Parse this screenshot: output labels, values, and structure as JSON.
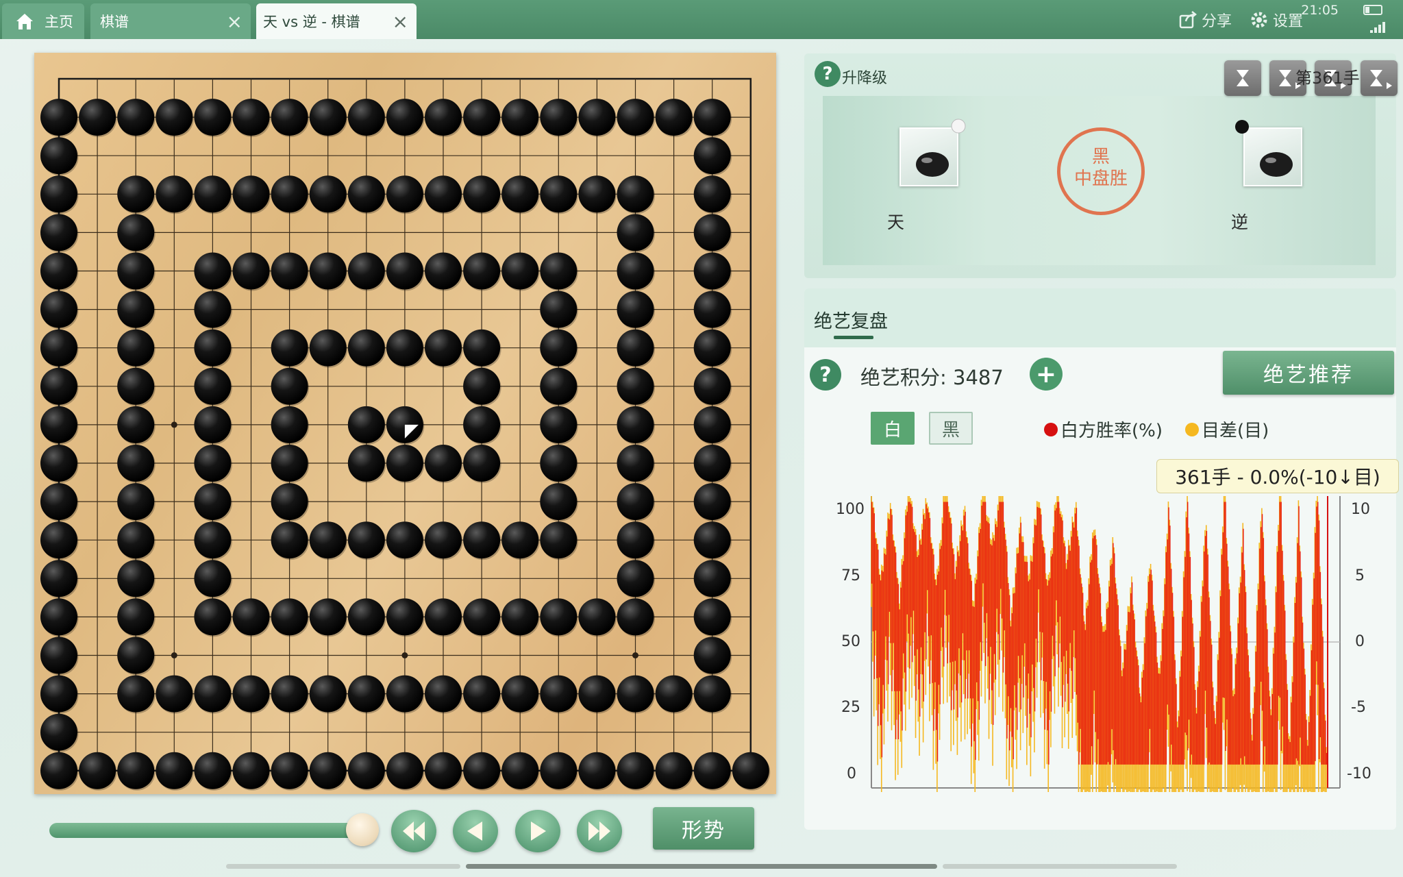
{
  "tabs": {
    "home": "主页",
    "record": "棋谱",
    "active": "天 vs 逆 - 棋谱",
    "close_glyph": "×"
  },
  "status": {
    "share": "分享",
    "settings": "设置",
    "time": "21:05"
  },
  "board": {
    "size": 19,
    "stones_black": [
      [
        0,
        1
      ],
      [
        1,
        1
      ],
      [
        2,
        1
      ],
      [
        3,
        1
      ],
      [
        4,
        1
      ],
      [
        5,
        1
      ],
      [
        6,
        1
      ],
      [
        7,
        1
      ],
      [
        8,
        1
      ],
      [
        9,
        1
      ],
      [
        10,
        1
      ],
      [
        11,
        1
      ],
      [
        12,
        1
      ],
      [
        13,
        1
      ],
      [
        14,
        1
      ],
      [
        15,
        1
      ],
      [
        16,
        1
      ],
      [
        17,
        1
      ],
      [
        0,
        2
      ],
      [
        17,
        2
      ],
      [
        0,
        3
      ],
      [
        2,
        3
      ],
      [
        3,
        3
      ],
      [
        4,
        3
      ],
      [
        5,
        3
      ],
      [
        6,
        3
      ],
      [
        7,
        3
      ],
      [
        8,
        3
      ],
      [
        9,
        3
      ],
      [
        10,
        3
      ],
      [
        11,
        3
      ],
      [
        12,
        3
      ],
      [
        13,
        3
      ],
      [
        14,
        3
      ],
      [
        15,
        3
      ],
      [
        17,
        3
      ],
      [
        0,
        4
      ],
      [
        2,
        4
      ],
      [
        15,
        4
      ],
      [
        17,
        4
      ],
      [
        0,
        5
      ],
      [
        2,
        5
      ],
      [
        4,
        5
      ],
      [
        5,
        5
      ],
      [
        6,
        5
      ],
      [
        7,
        5
      ],
      [
        8,
        5
      ],
      [
        9,
        5
      ],
      [
        10,
        5
      ],
      [
        11,
        5
      ],
      [
        12,
        5
      ],
      [
        13,
        5
      ],
      [
        15,
        5
      ],
      [
        17,
        5
      ],
      [
        0,
        6
      ],
      [
        2,
        6
      ],
      [
        4,
        6
      ],
      [
        13,
        6
      ],
      [
        15,
        6
      ],
      [
        17,
        6
      ],
      [
        0,
        7
      ],
      [
        2,
        7
      ],
      [
        4,
        7
      ],
      [
        6,
        7
      ],
      [
        7,
        7
      ],
      [
        8,
        7
      ],
      [
        9,
        7
      ],
      [
        10,
        7
      ],
      [
        11,
        7
      ],
      [
        13,
        7
      ],
      [
        15,
        7
      ],
      [
        17,
        7
      ],
      [
        0,
        8
      ],
      [
        2,
        8
      ],
      [
        4,
        8
      ],
      [
        6,
        8
      ],
      [
        11,
        8
      ],
      [
        13,
        8
      ],
      [
        15,
        8
      ],
      [
        17,
        8
      ],
      [
        0,
        9
      ],
      [
        2,
        9
      ],
      [
        4,
        9
      ],
      [
        6,
        9
      ],
      [
        8,
        9
      ],
      [
        9,
        9
      ],
      [
        11,
        9
      ],
      [
        13,
        9
      ],
      [
        15,
        9
      ],
      [
        17,
        9
      ],
      [
        0,
        10
      ],
      [
        2,
        10
      ],
      [
        4,
        10
      ],
      [
        6,
        10
      ],
      [
        8,
        10
      ],
      [
        9,
        10
      ],
      [
        10,
        10
      ],
      [
        11,
        10
      ],
      [
        13,
        10
      ],
      [
        15,
        10
      ],
      [
        17,
        10
      ],
      [
        0,
        11
      ],
      [
        2,
        11
      ],
      [
        4,
        11
      ],
      [
        6,
        11
      ],
      [
        13,
        11
      ],
      [
        15,
        11
      ],
      [
        17,
        11
      ],
      [
        0,
        12
      ],
      [
        2,
        12
      ],
      [
        4,
        12
      ],
      [
        6,
        12
      ],
      [
        7,
        12
      ],
      [
        8,
        12
      ],
      [
        9,
        12
      ],
      [
        10,
        12
      ],
      [
        11,
        12
      ],
      [
        12,
        12
      ],
      [
        13,
        12
      ],
      [
        15,
        12
      ],
      [
        17,
        12
      ],
      [
        0,
        13
      ],
      [
        2,
        13
      ],
      [
        4,
        13
      ],
      [
        15,
        13
      ],
      [
        17,
        13
      ],
      [
        0,
        14
      ],
      [
        2,
        14
      ],
      [
        4,
        14
      ],
      [
        5,
        14
      ],
      [
        6,
        14
      ],
      [
        7,
        14
      ],
      [
        8,
        14
      ],
      [
        9,
        14
      ],
      [
        10,
        14
      ],
      [
        11,
        14
      ],
      [
        12,
        14
      ],
      [
        13,
        14
      ],
      [
        14,
        14
      ],
      [
        15,
        14
      ],
      [
        17,
        14
      ],
      [
        0,
        15
      ],
      [
        2,
        15
      ],
      [
        17,
        15
      ],
      [
        0,
        16
      ],
      [
        2,
        16
      ],
      [
        3,
        16
      ],
      [
        4,
        16
      ],
      [
        5,
        16
      ],
      [
        6,
        16
      ],
      [
        7,
        16
      ],
      [
        8,
        16
      ],
      [
        9,
        16
      ],
      [
        10,
        16
      ],
      [
        11,
        16
      ],
      [
        12,
        16
      ],
      [
        13,
        16
      ],
      [
        14,
        16
      ],
      [
        15,
        16
      ],
      [
        16,
        16
      ],
      [
        17,
        16
      ],
      [
        0,
        17
      ],
      [
        0,
        18
      ],
      [
        1,
        18
      ],
      [
        2,
        18
      ],
      [
        3,
        18
      ],
      [
        4,
        18
      ],
      [
        5,
        18
      ],
      [
        6,
        18
      ],
      [
        7,
        18
      ],
      [
        8,
        18
      ],
      [
        9,
        18
      ],
      [
        10,
        18
      ],
      [
        11,
        18
      ],
      [
        12,
        18
      ],
      [
        13,
        18
      ],
      [
        14,
        18
      ],
      [
        15,
        18
      ],
      [
        16,
        18
      ],
      [
        17,
        18
      ],
      [
        18,
        18
      ]
    ],
    "last_move": [
      9,
      9
    ],
    "move_progress": 1.0
  },
  "controls": {
    "shape_button": "形势"
  },
  "game": {
    "rank_label": "升降级",
    "move_label": "第361手",
    "player_white": "天",
    "player_black": "逆",
    "result_line1": "黑",
    "result_line2": "中盘胜"
  },
  "analysis": {
    "title": "绝艺复盘",
    "score_label": "绝艺积分: 3487",
    "recommend_button": "绝艺推荐",
    "toggle_white": "白",
    "toggle_black": "黑",
    "legend_winrate": "白方胜率(%)",
    "legend_diff": "目差(目)",
    "tooltip": "361手 - 0.0%(-10↓目)"
  },
  "chart_data": {
    "type": "line",
    "x_range": [
      1,
      361
    ],
    "left_axis": {
      "label": "",
      "ticks": [
        "100",
        "75",
        "50",
        "25",
        "0"
      ],
      "ylim": [
        0,
        100
      ]
    },
    "right_axis": {
      "label": "",
      "ticks": [
        "10",
        "5",
        "0",
        "-5",
        "-10"
      ],
      "ylim": [
        -10,
        10
      ]
    },
    "series": [
      {
        "name": "白方胜率(%)",
        "color": "#e8150f"
      },
      {
        "name": "目差(目)",
        "color": "#f5b820"
      }
    ],
    "winrate_profile": [
      92,
      60,
      88,
      55,
      95,
      70,
      90,
      58,
      97,
      65,
      85,
      52,
      93,
      72,
      96,
      48,
      80,
      62,
      91,
      57,
      94,
      68,
      86,
      45,
      82,
      40,
      75,
      30,
      60,
      20,
      70,
      25,
      88,
      10,
      92,
      15,
      85,
      8,
      95,
      20,
      78,
      5,
      90,
      12,
      96,
      3,
      85,
      2,
      99,
      0
    ],
    "colors": {
      "winrate": "#e8150f",
      "diff": "#f5b820"
    }
  }
}
